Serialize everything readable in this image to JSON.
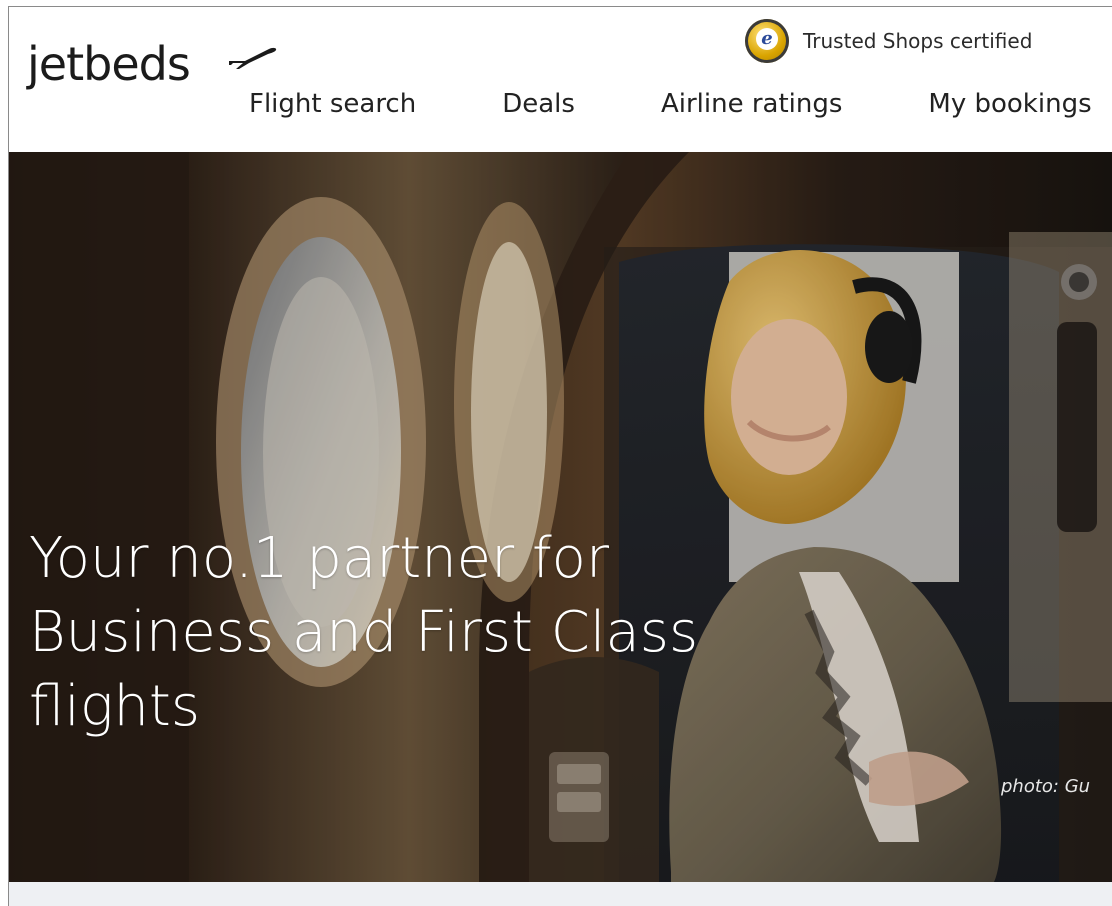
{
  "brand": {
    "logo_text": "jetbeds"
  },
  "trust": {
    "label": "Trusted Shops certified",
    "seal_letter": "e"
  },
  "nav": {
    "items": [
      "Flight search",
      "Deals",
      "Airline ratings",
      "My bookings"
    ]
  },
  "hero": {
    "headline_line1": "Your no.1 partner for",
    "headline_line2": "Business and First Class",
    "headline_line3": "flights",
    "photo_credit": "photo: Gu"
  },
  "colors": {
    "text_dark": "#1b1b1b",
    "hero_text": "#ffffff",
    "band_bg": "#eef0f3"
  }
}
